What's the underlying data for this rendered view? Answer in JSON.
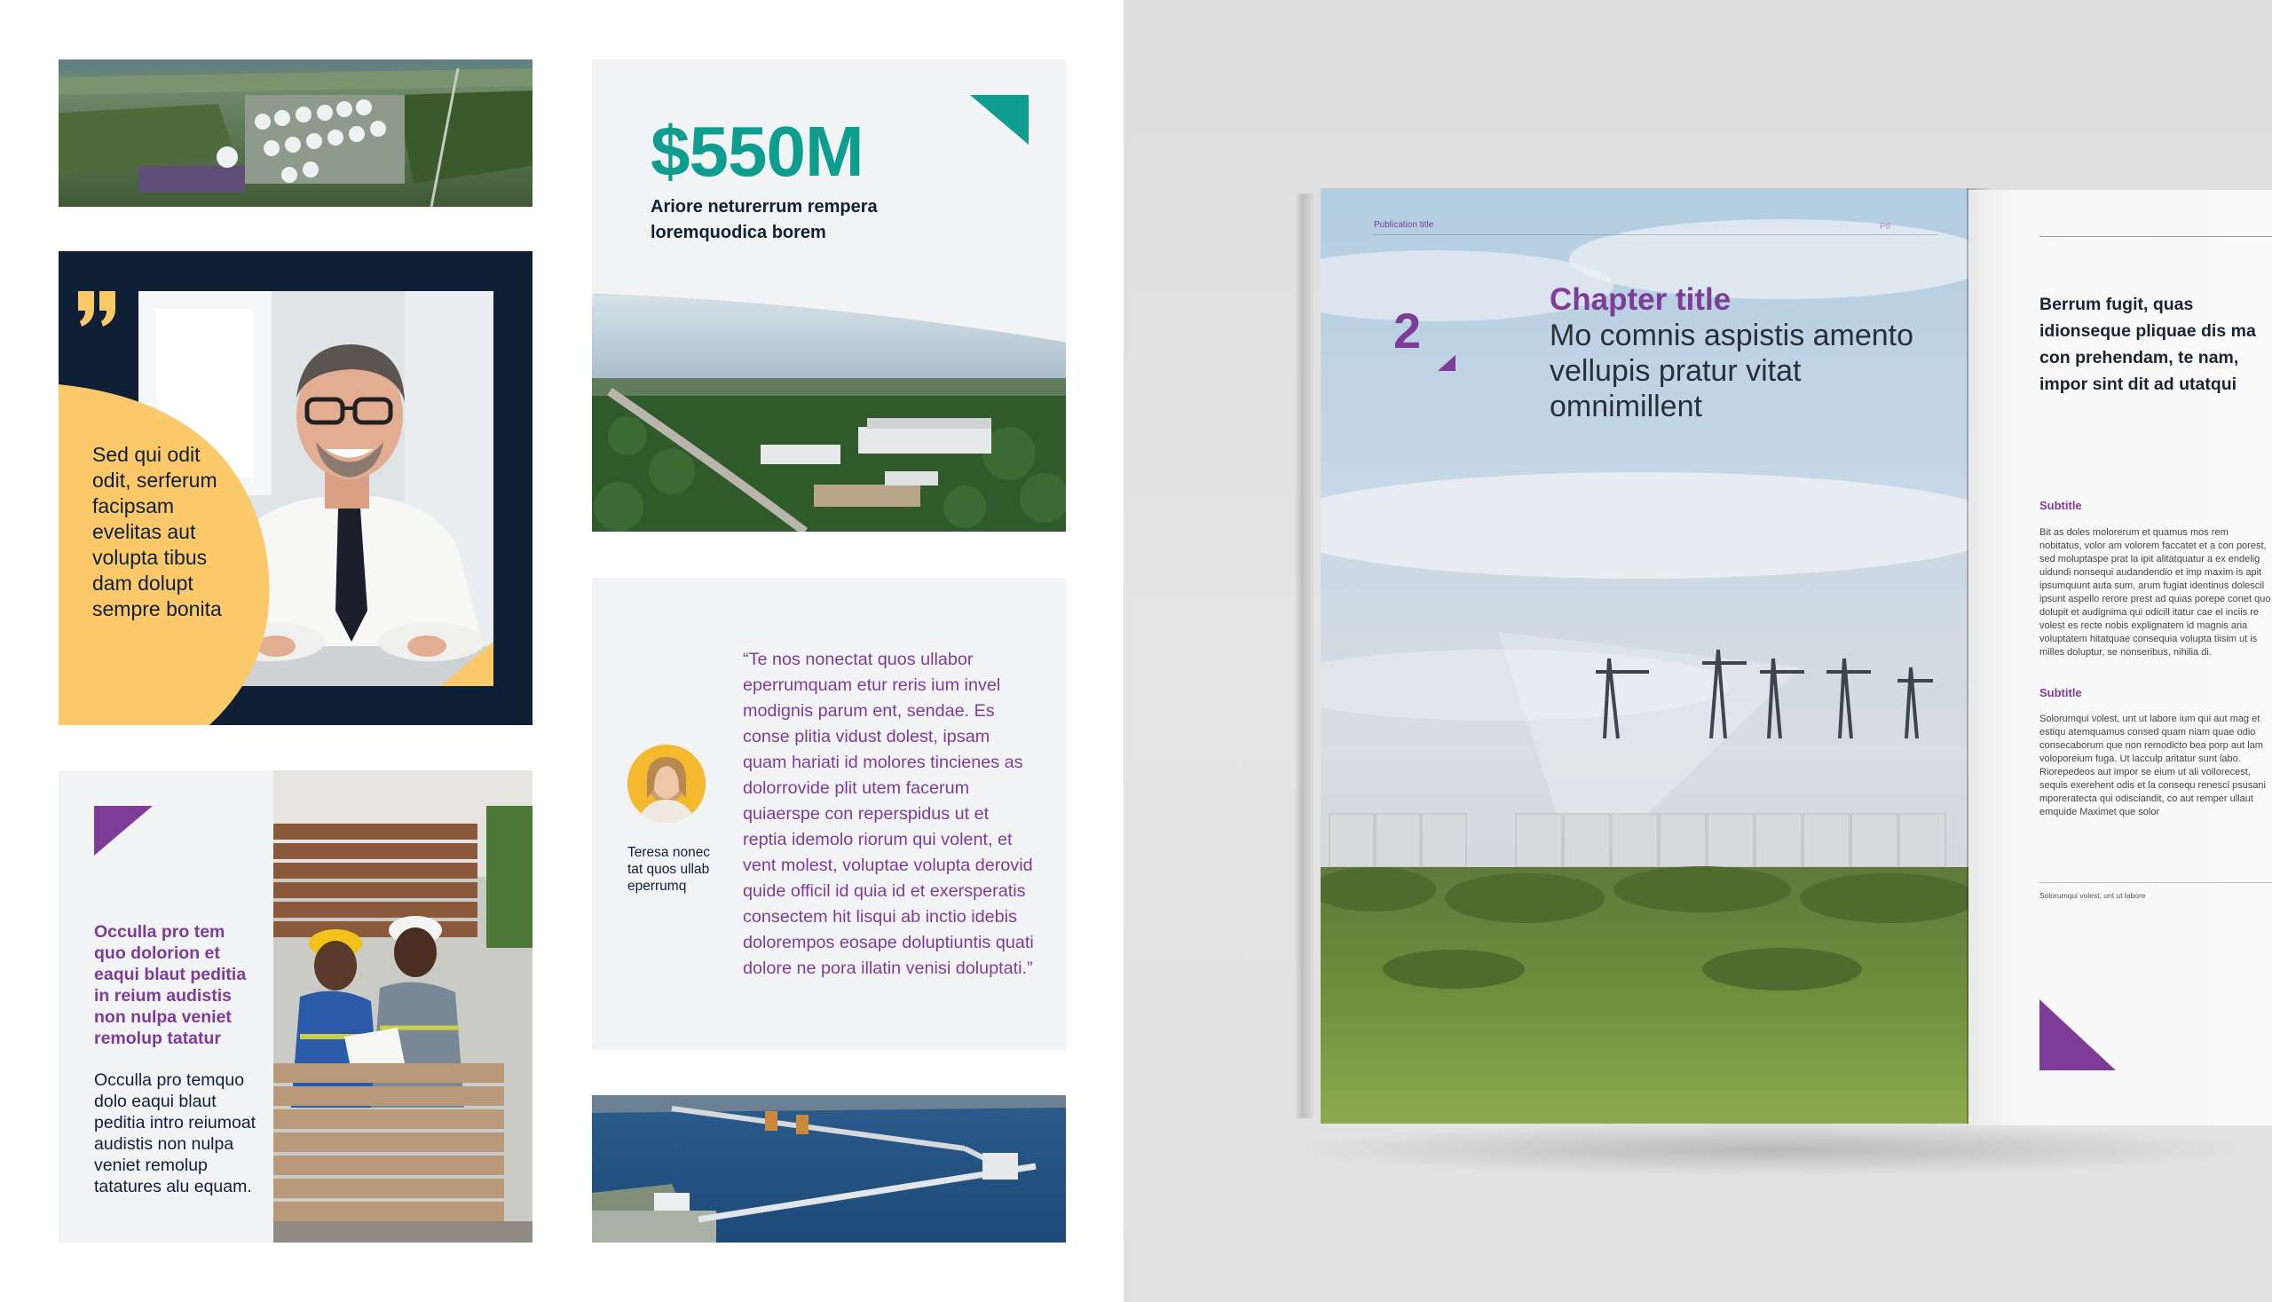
{
  "colors": {
    "teal": "#0e9d8f",
    "navy": "#0f2036",
    "yellow": "#fbc86a",
    "purple": "#7d3c98",
    "card_gray": "#f2f3f5"
  },
  "quote_card": {
    "icon": "quotation-mark-icon",
    "text": "Sed qui odit odit, serferum facipsam evelitas aut volupta tibus dam dolupt sempre bonita"
  },
  "stat_card": {
    "value": "$550M",
    "caption": "Ariore neturerrum rempera loremquodica borem"
  },
  "testimonial": {
    "name": "Teresa nonec tat quos ullab eperrumq",
    "quote": "“Te nos nonectat quos ullabor eperrumquam etur reris ium invel modignis parum ent, sendae. Es conse plitia vidust dolest, ipsam quam hariati id molores tincienes as dolorrovide plit utem facerum quiaerspe con reperspidus ut et reptia idemolo riorum qui volent, et vent molest, voluptae volupta derovid quide officil id quia id et exersperatis consectem hit lisqui ab inctio idebis dolorempos eosape doluptiuntis quati dolore ne pora illatin venisi doluptati.”"
  },
  "workers_card": {
    "highlight": "Occulla pro tem quo dolorion et eaqui blaut peditia in reium audistis non nulpa veniet remolup tatatur",
    "body": "Occulla pro temquo dolo eaqui blaut peditia intro reiumoat audistis non nulpa veniet remolup tatatures alu equam."
  },
  "brochure": {
    "left_page": {
      "publication_title": "Publication title",
      "page_number": "P8",
      "chapter_number": "2",
      "chapter_title": "Chapter title",
      "chapter_subtitle": "Mo comnis aspistis amento vellupis pratur vitat omnimillent"
    },
    "right_page": {
      "lead": "Berrum fugit, quas idionseque pliquae dis ma con prehendam, te nam, impor sint dit ad utatqui",
      "subtitle_1": "Subtitle",
      "body_1": "Bit as doles molorerum et quamus mos rem nobitatus, volor am volorem faccatet et a con porest, sed moluptaspe prat la ipit alitatquatur a ex endelig uidundi nonsequi audandendio et imp maxim is apit ipsumquunt auta sum, arum fugiat identinus dolescil ipsunt aspello rerore prest ad quias porepe conet quo dolupit et audignima qui odicill itatur cae el inciis re volest es recte nobis explignatem id magnis aria voluptatem hitatquae consequia volupta tiisim ut is milles doluptur, se nonseribus, nihilia di.",
      "subtitle_2": "Subtitle",
      "body_2": "Solorumqui volest, unt ut labore ium qui aut mag et estiqu atemquamus consed quam niam quae odio consecaborum que non remodicto bea porp aut lam voloporeium fuga. Ut lacculp aritatur sunt labo. Riorepedeos aut impor se eium ut ali vollorecest, sequis exerehent odis et la consequ renesci psusani mporeratecta qui odisciandit, co aut remper ullaut emquide  Maximet que solor",
      "footnote": "Solorumqui volest, unt ut labore"
    }
  }
}
